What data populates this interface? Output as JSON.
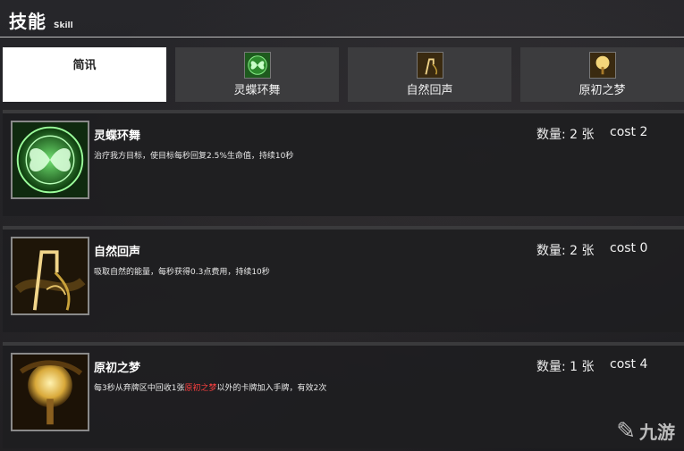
{
  "header": {
    "title": "技能",
    "subtitle": "Skill"
  },
  "tabs": [
    {
      "label": "简讯",
      "icon": "none"
    },
    {
      "label": "灵蝶环舞",
      "icon": "butterfly-icon"
    },
    {
      "label": "自然回声",
      "icon": "staff-icon"
    },
    {
      "label": "原初之梦",
      "icon": "tree-icon"
    }
  ],
  "cards": [
    {
      "name": "灵蝶环舞",
      "desc": "治疗我方目标，使目标每秒回复2.5%生命值，持续10秒",
      "qty": "数量: 2 张",
      "cost": "cost 2",
      "icon": "butterfly-icon"
    },
    {
      "name": "自然回声",
      "desc": "吸取自然的能量，每秒获得0.3点费用，持续10秒",
      "qty": "数量: 2 张",
      "cost": "cost 0",
      "icon": "staff-icon"
    },
    {
      "name": "原初之梦",
      "desc_pre": "每3秒从弃牌区中回收1张",
      "desc_hl": "原初之梦",
      "desc_post": "以外的卡牌加入手牌，有效2次",
      "qty": "数量: 1 张",
      "cost": "cost 4",
      "icon": "tree-icon"
    }
  ],
  "watermark": {
    "text": "九游"
  },
  "colors": {
    "highlight": "#ff4040",
    "green": "#3dbb3d",
    "gold": "#c9a23a"
  }
}
